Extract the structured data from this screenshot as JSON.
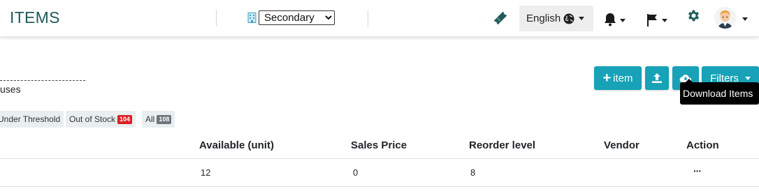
{
  "header": {
    "title": "ITEMS",
    "branch_selected": "Secondary",
    "language_label": "English"
  },
  "breadcrumb": {
    "text": "uses"
  },
  "actions": {
    "add_item_label": "item",
    "filters_label": "Filters",
    "download_tooltip": "Download Items"
  },
  "status_filters": [
    {
      "label": "Under Threshold",
      "count": ""
    },
    {
      "label": "Out of Stock",
      "count": "104",
      "color": "#dc3545"
    },
    {
      "label": "All",
      "count": "108",
      "color": "#6c757d"
    }
  ],
  "table": {
    "columns": [
      "Available (unit)",
      "Sales Price",
      "Reorder level",
      "Vendor",
      "Action"
    ],
    "rows": [
      {
        "available": "12",
        "sales_price": "0",
        "reorder_level": "8",
        "vendor": "",
        "action": "···"
      }
    ]
  },
  "colors": {
    "brand_title": "#1f5c59",
    "action_button": "#17a2b8"
  }
}
